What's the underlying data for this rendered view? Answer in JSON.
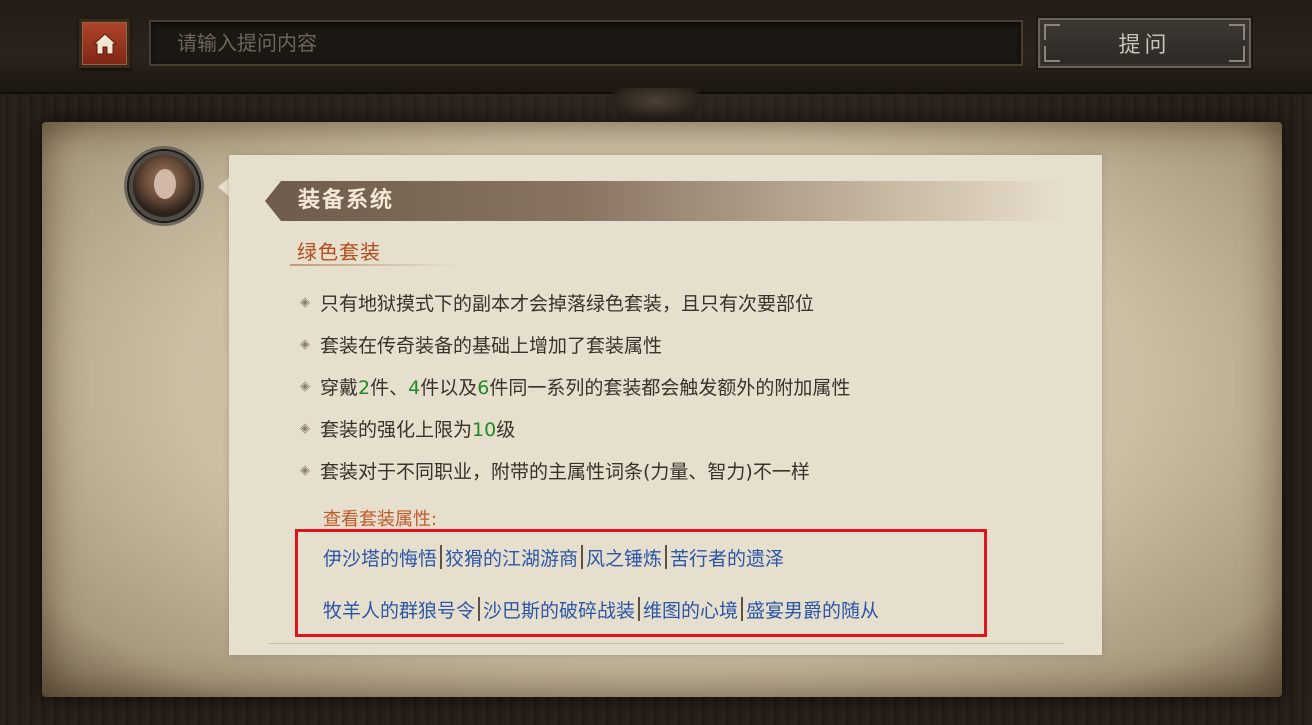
{
  "topbar": {
    "search_placeholder": "请输入提问内容",
    "ask_label": "提问",
    "home_icon": "home-icon"
  },
  "card": {
    "title": "装备系统",
    "subtitle": "绿色套装",
    "bullets": [
      {
        "parts": [
          {
            "text": "只有地狱摸式下的副本才会掉落绿色套装，且只有次要部位",
            "green": false
          }
        ]
      },
      {
        "parts": [
          {
            "text": "套装在传奇装备的基础上增加了套装属性",
            "green": false
          }
        ]
      },
      {
        "parts": [
          {
            "text": "穿戴",
            "green": false
          },
          {
            "text": "2",
            "green": true
          },
          {
            "text": "件、",
            "green": false
          },
          {
            "text": "4",
            "green": true
          },
          {
            "text": "件以及",
            "green": false
          },
          {
            "text": "6",
            "green": true
          },
          {
            "text": "件同一系列的套装都会触发额外的附加属性",
            "green": false
          }
        ]
      },
      {
        "parts": [
          {
            "text": "套装的强化上限为",
            "green": false
          },
          {
            "text": "10",
            "green": true
          },
          {
            "text": "级",
            "green": false
          }
        ]
      },
      {
        "parts": [
          {
            "text": "套装对于不同职业，附带的主属性词条(力量、智力)不一样",
            "green": false
          }
        ]
      }
    ],
    "view_label": "查看套装属性:",
    "link_rows": [
      [
        "伊沙塔的悔悟",
        "狡猾的江湖游商",
        "风之锤炼",
        "苦行者的遗泽"
      ],
      [
        "牧羊人的群狼号令",
        "沙巴斯的破碎战装",
        "维图的心境",
        "盛宴男爵的随从"
      ]
    ]
  },
  "colors": {
    "accent_orange": "#b24c1d",
    "link_blue": "#2b56a8",
    "highlight_red": "#e0141c",
    "number_green": "#1f8a22"
  }
}
